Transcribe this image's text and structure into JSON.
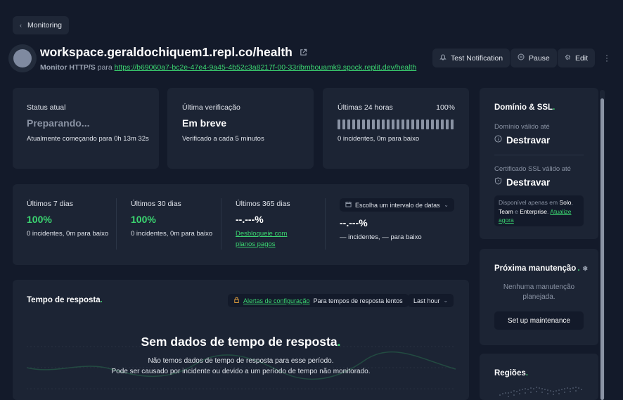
{
  "nav": {
    "back_label": "Monitoring"
  },
  "header": {
    "title": "workspace.geraldochiquem1.repl.co/health",
    "monitor_type": "Monitor HTTP/S",
    "for_word": "para",
    "url": "https://b69060a7-bc2e-47e4-9a45-4b52c3a8217f-00-33ribmbouamk9.spock.replit.dev/health",
    "buttons": {
      "test_notification": "Test Notification",
      "pause": "Pause",
      "edit": "Edit"
    }
  },
  "status": {
    "current": {
      "label": "Status atual",
      "value": "Preparando...",
      "detail": "Atualmente começando para 0h 13m 32s"
    },
    "last_check": {
      "label": "Última verificação",
      "value": "Em breve",
      "detail": "Verificado a cada 5 minutos"
    },
    "last24": {
      "label": "Últimas 24 horas",
      "percent": "100%",
      "detail": "0 incidentes, 0m para baixo"
    }
  },
  "uptime": {
    "d7": {
      "label": "Últimos 7 dias",
      "value": "100%",
      "detail": "0 incidentes, 0m para baixo"
    },
    "d30": {
      "label": "Últimos 30 dias",
      "value": "100%",
      "detail": "0 incidentes, 0m para baixo"
    },
    "d365": {
      "label": "Últimos 365 dias",
      "value": "--.---%",
      "link": "Desbloqueie com planos pagos"
    },
    "range": {
      "picker_label": "Escolha um intervalo de datas",
      "value": "--.---%",
      "detail": "— incidentes, — para baixo"
    }
  },
  "response": {
    "title": "Tempo de resposta",
    "alerts_link": "Alertas de configuração",
    "alerts_text": "Para tempos de resposta lentos",
    "period": "Last hour",
    "empty_title": "Sem dados de tempo de resposta",
    "empty_line1": "Não temos dados de tempo de resposta para esse período.",
    "empty_line2": "Pode ser causado por incidente ou devido a um período de tempo não monitorado."
  },
  "sidebar": {
    "domain_ssl": {
      "title": "Domínio & SSL",
      "domain_label": "Domínio válido até",
      "domain_value": "Destravar",
      "ssl_label": "Certificado SSL válido até",
      "ssl_value": "Destravar",
      "note_prefix": "Disponível apenas em",
      "plan_solo": "Solo",
      "plan_team": "Team",
      "plan_enterprise": "Enterprise",
      "and_word": "e",
      "upgrade_link": "Atualize agora"
    },
    "maintenance": {
      "title": "Próxima manutenção",
      "empty": "Nenhuma manutenção planejada.",
      "button": "Set up maintenance"
    },
    "regions": {
      "title": "Regiões"
    }
  },
  "colors": {
    "accent": "#3bd671",
    "background": "#131a2a",
    "card": "#1c2434"
  },
  "icons": [
    "chevron-left-icon",
    "external-link-icon",
    "bell-icon",
    "pause-icon",
    "gear-icon",
    "kebab-icon",
    "info-icon",
    "shield-icon",
    "calendar-icon",
    "lock-icon",
    "chevron-down-icon",
    "snowflake-icon"
  ]
}
